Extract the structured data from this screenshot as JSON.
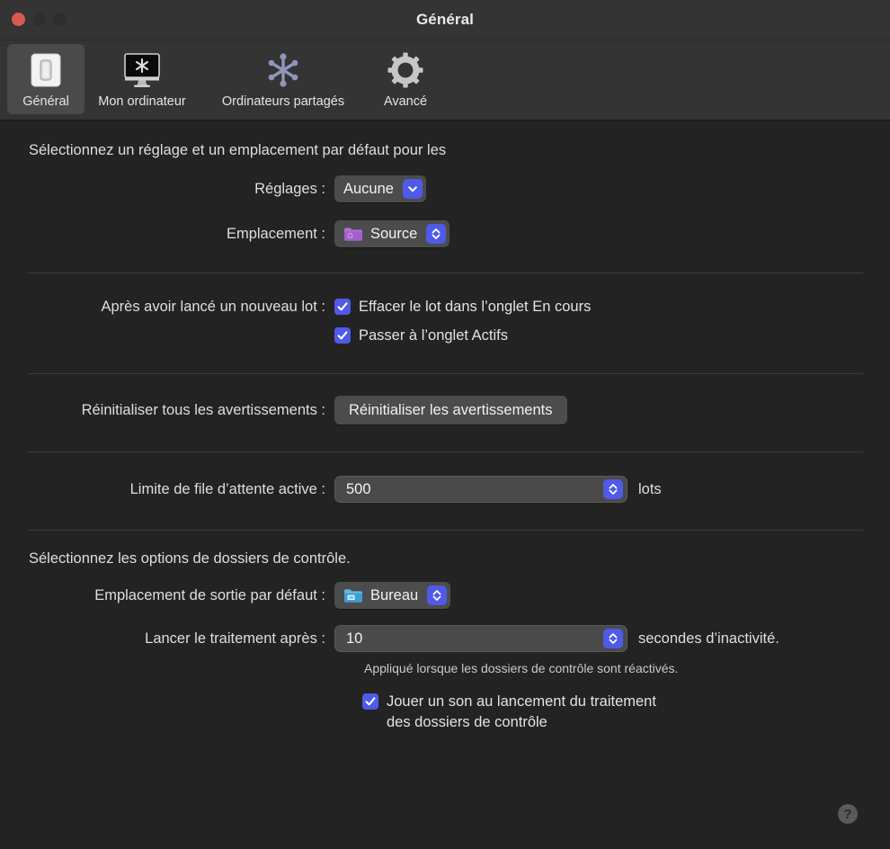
{
  "window": {
    "title": "Général",
    "traffic_lights": [
      {
        "name": "close",
        "color": "#d9594f"
      },
      {
        "name": "minimize",
        "color": "#2e2e2e"
      },
      {
        "name": "zoom",
        "color": "#2e2e2e"
      }
    ]
  },
  "toolbar": {
    "items": [
      {
        "label": "Général",
        "icon": "toggle-switch-icon",
        "selected": true
      },
      {
        "label": "Mon ordinateur",
        "icon": "display-asterisk-icon",
        "selected": false
      },
      {
        "label": "Ordinateurs partagés",
        "icon": "asterisk-network-icon",
        "selected": false
      },
      {
        "label": "Avancé",
        "icon": "gear-icon",
        "selected": false
      }
    ]
  },
  "sections": {
    "defaults": {
      "heading": "Sélectionnez un réglage et un emplacement par défaut pour les",
      "settings_label": "Réglages :",
      "settings_value": "Aucune",
      "location_label": "Emplacement :",
      "location_value": "Source",
      "location_icon": "purple-folder-icon"
    },
    "after_batch": {
      "label": "Après avoir lancé un nouveau lot :",
      "checkbox_clear": {
        "label": "Effacer le lot dans l’onglet En cours",
        "checked": true
      },
      "checkbox_switch": {
        "label": "Passer à l’onglet Actifs",
        "checked": true
      }
    },
    "warnings": {
      "label": "Réinitialiser tous les avertissements :",
      "button": "Réinitialiser les avertissements"
    },
    "queue": {
      "label": "Limite de file d’attente active :",
      "value": "500",
      "suffix": "lots"
    },
    "watched_folders": {
      "heading": "Sélectionnez les options de dossiers de contrôle.",
      "output_label": "Emplacement de sortie par défaut :",
      "output_value": "Bureau",
      "output_icon": "blue-desktop-folder-icon",
      "delay_label": "Lancer le traitement après :",
      "delay_value": "10",
      "delay_suffix": "secondes d’inactivité.",
      "hint": "Appliqué lorsque les dossiers de contrôle sont réactivés.",
      "sound_checkbox": {
        "line1": "Jouer un son au lancement du traitement",
        "line2": "des dossiers de contrôle",
        "checked": true
      }
    }
  },
  "help": {
    "glyph": "?"
  },
  "colors": {
    "accent_blue": "#4f5ae8",
    "window_bg": "#232323",
    "chrome_bg": "#343434",
    "control_bg": "#4c4c4c",
    "text": "#dedede",
    "separator": "#3c3c3c"
  }
}
